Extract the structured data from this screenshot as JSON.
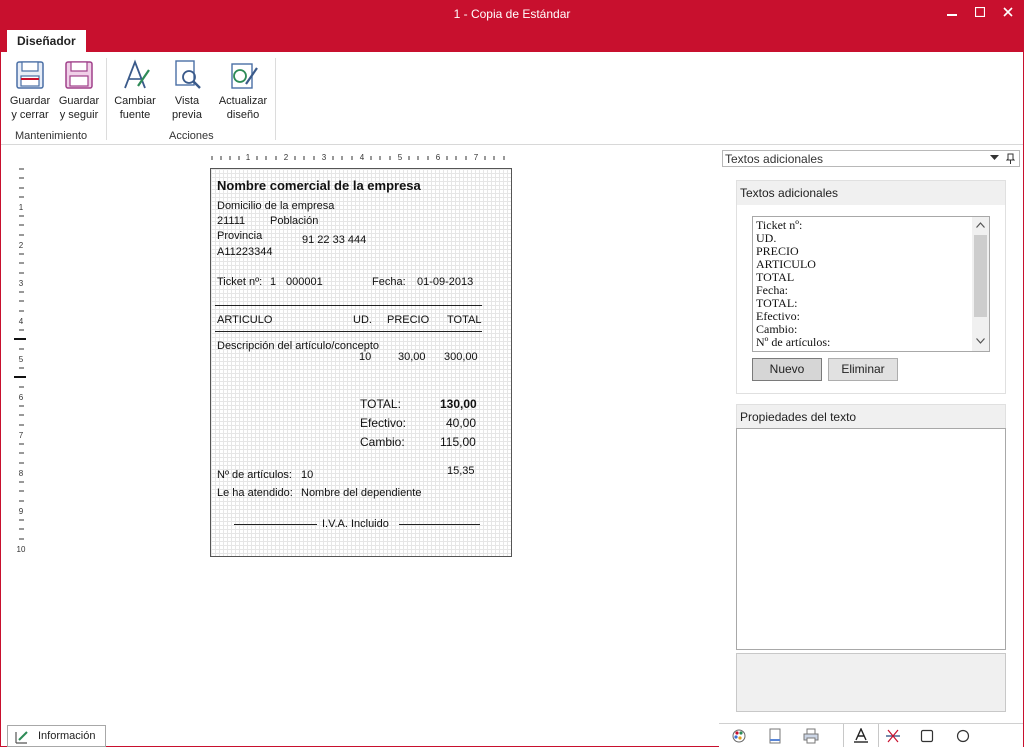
{
  "window": {
    "title": "1 - Copia de Estándar"
  },
  "ribbon": {
    "tab": "Diseñador",
    "buttons": {
      "guardar_cerrar": [
        "Guardar",
        "y cerrar"
      ],
      "guardar_seguir": [
        "Guardar",
        "y seguir"
      ],
      "cambiar_fuente": [
        "Cambiar",
        "fuente"
      ],
      "vista_previa": [
        "Vista",
        "previa"
      ],
      "actualizar": [
        "Actualizar",
        "diseño"
      ]
    },
    "groups": {
      "mantenimiento": "Mantenimiento",
      "acciones": "Acciones"
    }
  },
  "rulers": {
    "horizontal": [
      "1",
      "2",
      "3",
      "4",
      "5",
      "6",
      "7"
    ],
    "vertical": [
      "1",
      "2",
      "3",
      "4",
      "5",
      "6",
      "7",
      "8",
      "9",
      "10"
    ]
  },
  "ticket": {
    "company": "Nombre  comercial de la empresa",
    "address": "Domicilio de la empresa",
    "postal_code": "21111",
    "city": "Población",
    "province": "Provincia",
    "phone": "91 22 33 444",
    "tax_id": "A11223344",
    "ticket_label": "Ticket nº:",
    "ticket_series": "1",
    "ticket_number": "000001",
    "date_label": "Fecha:",
    "date_value": "01-09-2013",
    "col_article": "ARTICULO",
    "col_units": "UD.",
    "col_price": "PRECIO",
    "col_total": "TOTAL",
    "item_description": "Descripción del artículo/concepto",
    "item_units": "10",
    "item_price": "30,00",
    "item_total": "300,00",
    "total_label": "TOTAL:",
    "total_value": "130,00",
    "cash_label": "Efectivo:",
    "cash_value": "40,00",
    "change_label": "Cambio:",
    "change_value": "115,00",
    "tax_amount": "15,35",
    "items_count_label": "Nº de artículos:",
    "items_count_value": "10",
    "served_label": "Le ha atendido:",
    "served_value": "Nombre del dependiente",
    "vat_note": "I.V.A. Incluido"
  },
  "right_panel": {
    "dropdown": "Textos adicionales",
    "section_title": "Textos adicionales",
    "list_items": [
      "Ticket nº:",
      "UD.",
      "PRECIO",
      "ARTICULO",
      "TOTAL",
      "Fecha:",
      "TOTAL:",
      "Efectivo:",
      "Cambio:",
      "Nº de artículos:"
    ],
    "btn_new": "Nuevo",
    "btn_delete": "Eliminar",
    "properties_title": "Propiedades del texto"
  },
  "bottom": {
    "info_button": "Información"
  },
  "colors": {
    "accent": "#c8102e"
  }
}
